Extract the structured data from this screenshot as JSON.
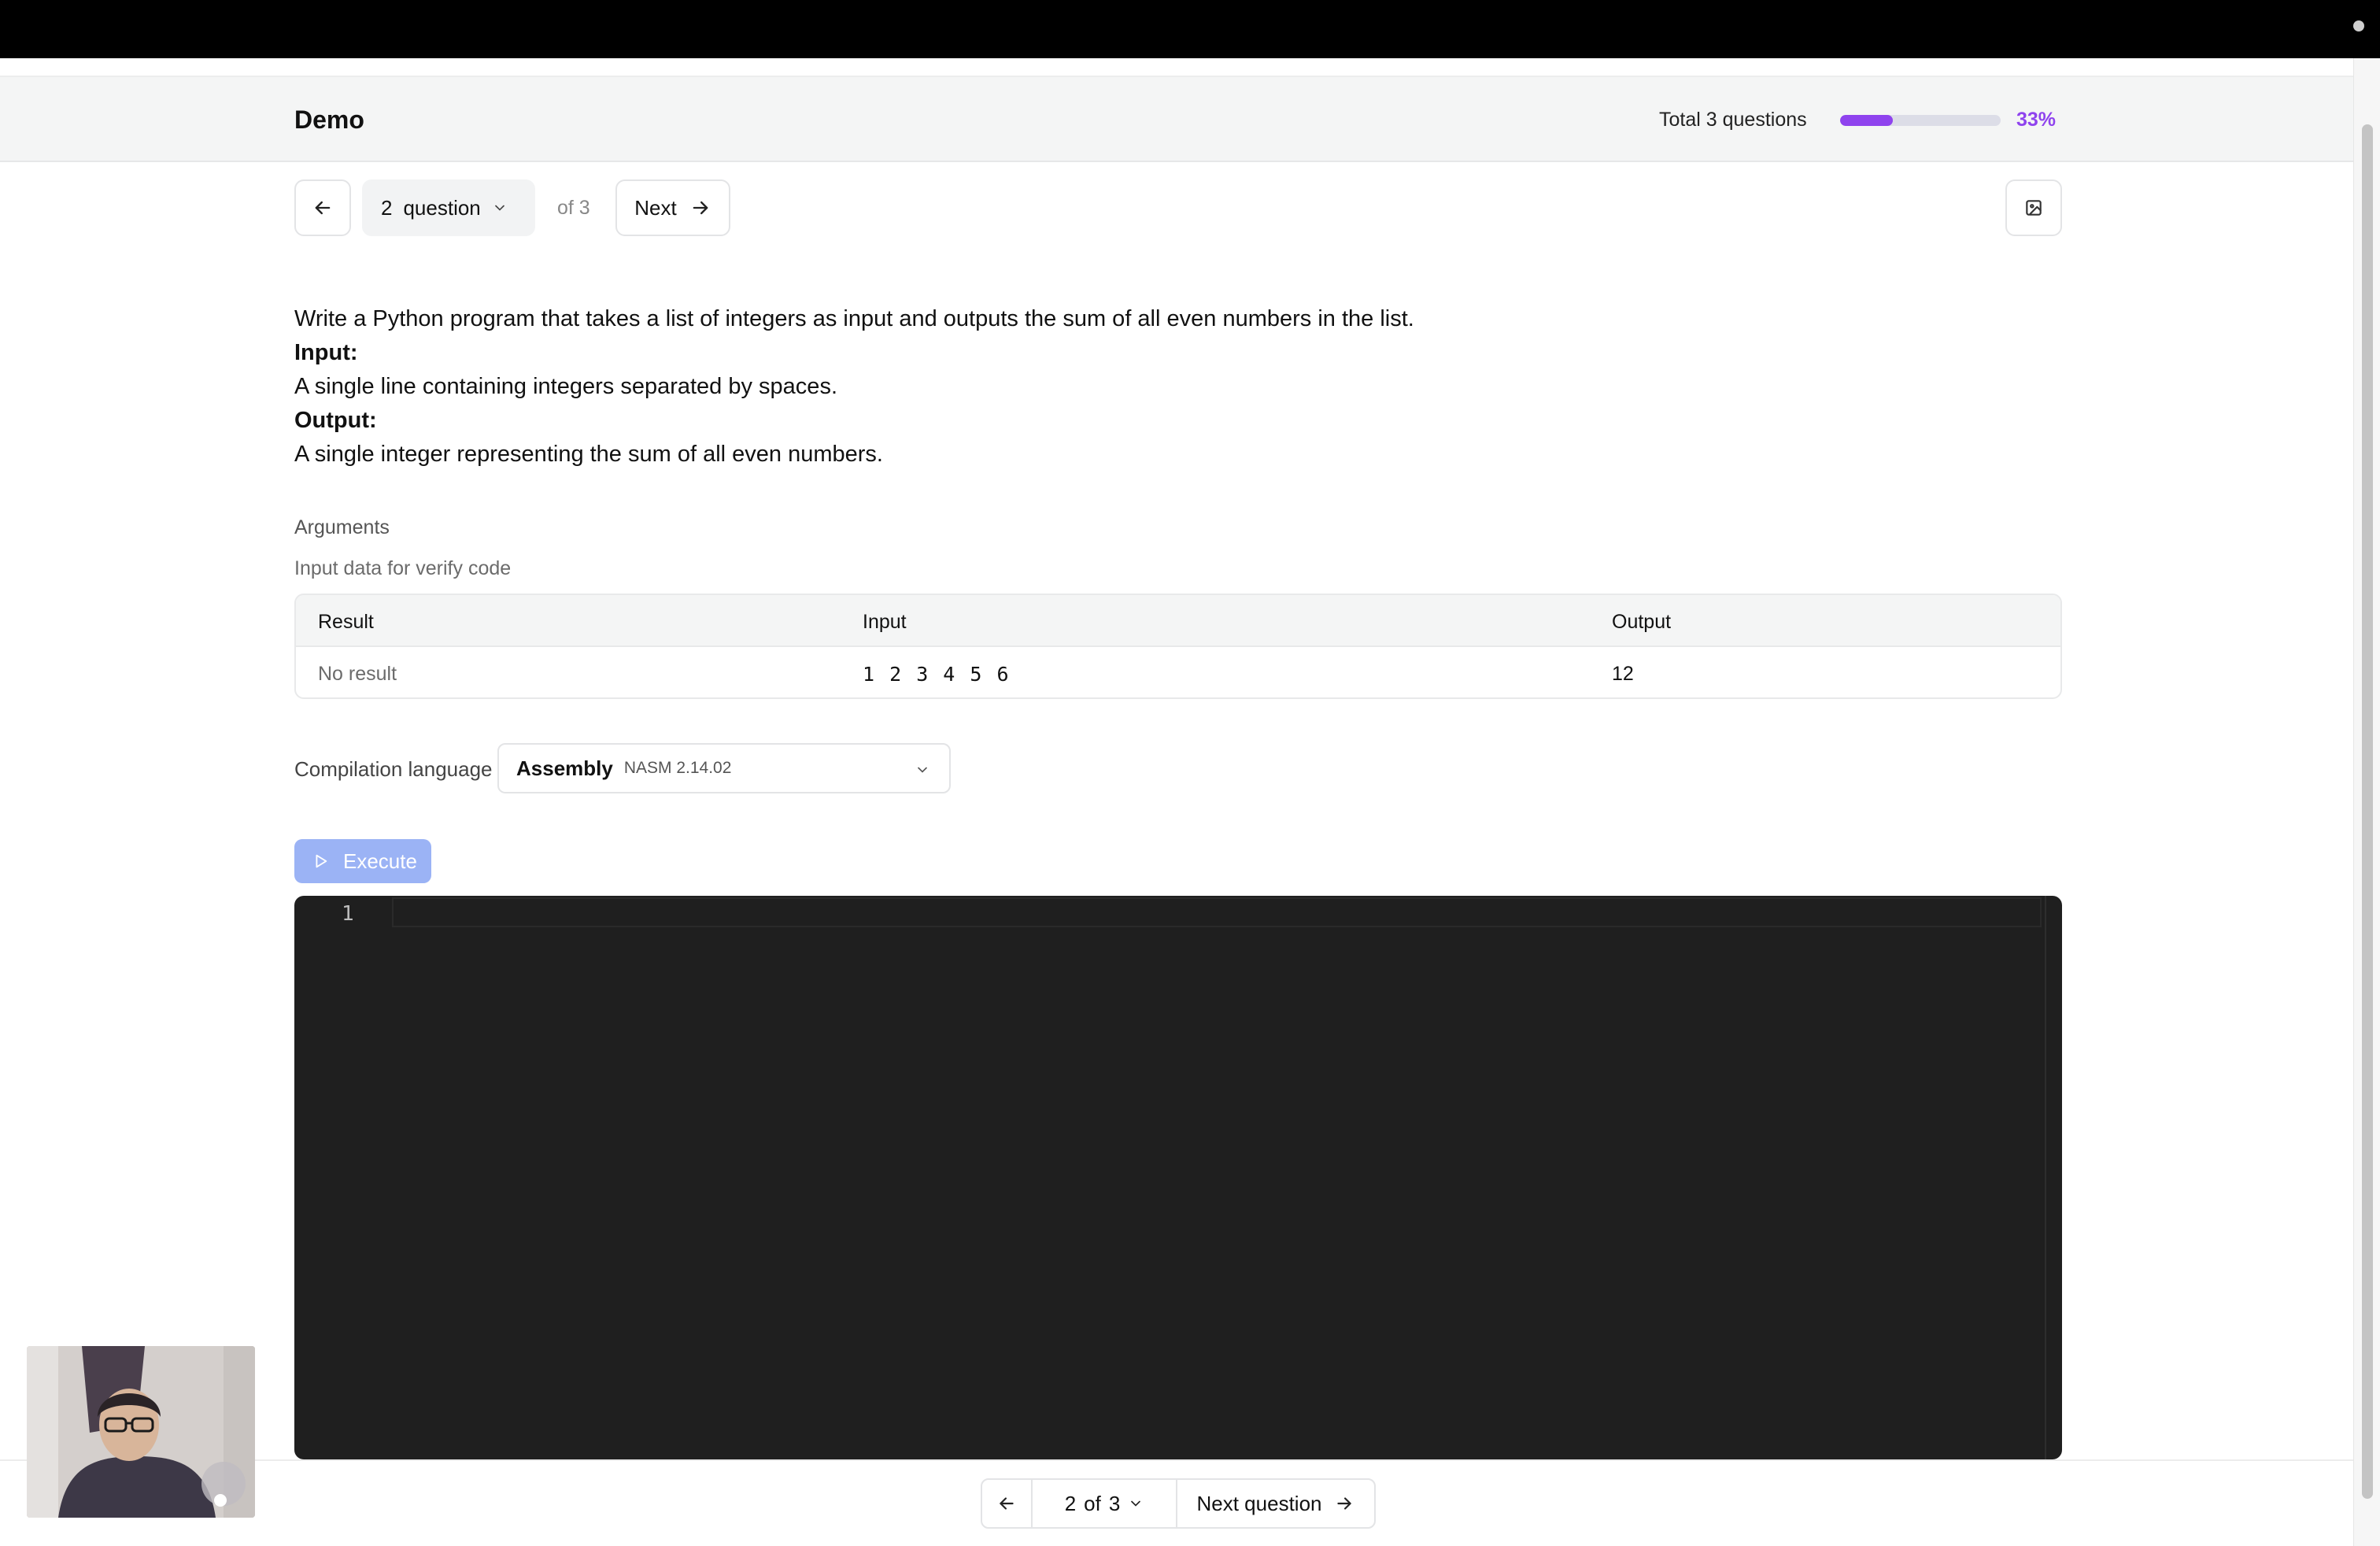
{
  "header": {
    "title": "Demo",
    "total_label": "Total 3 questions",
    "progress_fraction": 0.33,
    "progress_pct": "33%",
    "accent_color": "#8f43ee"
  },
  "nav": {
    "prev_icon": "arrow-left-icon",
    "question_number": "2",
    "question_word": "question",
    "of_label": "of 3",
    "next_label": "Next",
    "next_icon": "arrow-right-icon",
    "image_icon": "image-icon"
  },
  "question": {
    "description": "Write a Python program that takes a list of integers as input and outputs the sum of all even numbers in the list.",
    "input_heading": "Input:",
    "input_text": "A single line containing integers separated by spaces.",
    "output_heading": "Output:",
    "output_text": "A single integer representing the sum of all even numbers."
  },
  "arguments": {
    "title": "Arguments",
    "subtitle": "Input data for verify code",
    "columns": [
      "Result",
      "Input",
      "Output"
    ],
    "rows": [
      {
        "result": "No result",
        "input": "1 2 3 4 5 6",
        "output": "12"
      }
    ]
  },
  "compilation": {
    "label": "Compilation language",
    "language": "Assembly",
    "version": "NASM 2.14.02"
  },
  "execute": {
    "label": "Execute",
    "icon": "play-icon",
    "color": "#9bb3f5"
  },
  "editor": {
    "line_numbers": [
      "1"
    ],
    "content": ""
  },
  "pager": {
    "current": "2",
    "of": "of",
    "total": "3",
    "next_label": "Next question"
  }
}
